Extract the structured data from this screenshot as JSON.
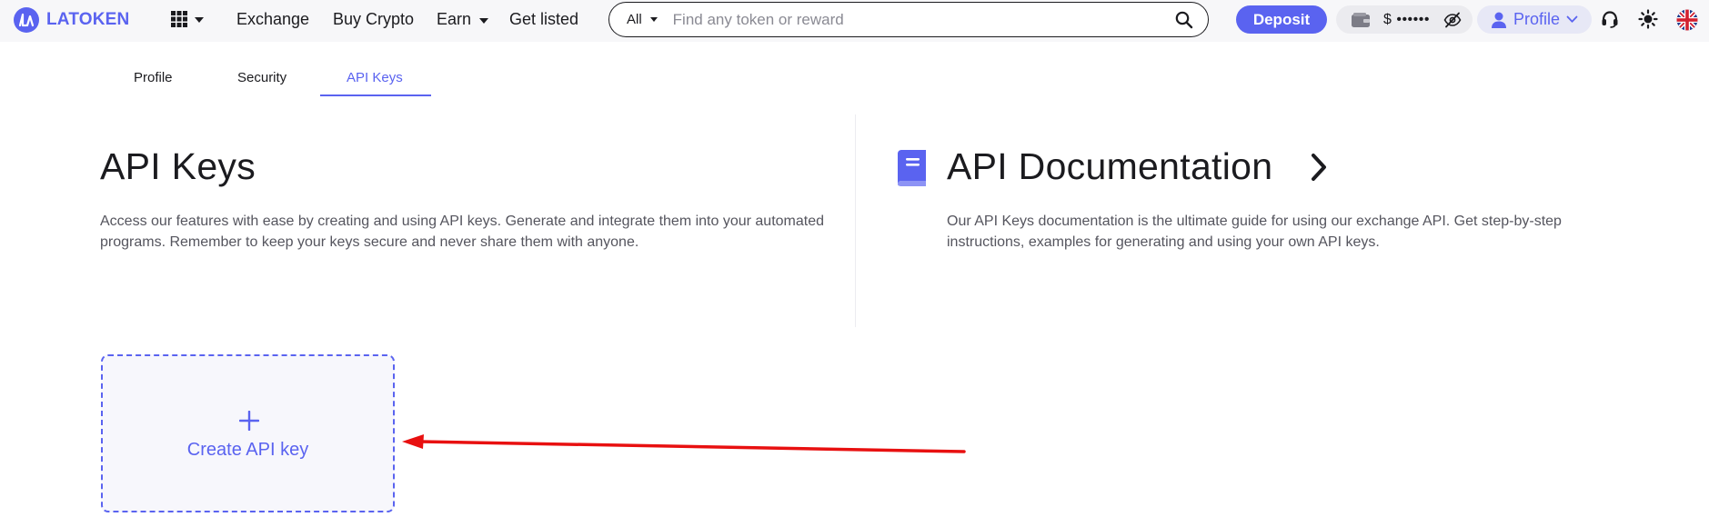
{
  "brand": {
    "name": "LATOKEN",
    "color": "#5a63f0"
  },
  "nav": {
    "grid_icon": "grid-icon",
    "links": [
      {
        "label": "Exchange"
      },
      {
        "label": "Buy Crypto"
      },
      {
        "label": "Earn",
        "has_dropdown": true
      },
      {
        "label": "Get listed"
      }
    ]
  },
  "search": {
    "category": "All",
    "placeholder": "Find any token or reward",
    "value": ""
  },
  "header_actions": {
    "deposit_label": "Deposit",
    "balance": "$ ••••••",
    "profile_label": "Profile",
    "icons": [
      "wallet-icon",
      "eye-off-icon",
      "user-icon",
      "support-icon",
      "theme-icon",
      "uk-flag-icon"
    ]
  },
  "tabs": [
    {
      "label": "Profile",
      "active": false
    },
    {
      "label": "Security",
      "active": false
    },
    {
      "label": "API Keys",
      "active": true
    }
  ],
  "api_keys": {
    "title": "API Keys",
    "description": "Access our features with ease by creating and using API keys. Generate and integrate them into your automated programs. Remember to keep your keys secure and never share them with anyone.",
    "create_label": "Create API key"
  },
  "api_docs": {
    "title": "API Documentation",
    "description": "Our API Keys documentation is the ultimate guide for using our exchange API. Get step-by-step instructions, examples for generating and using your own API keys."
  },
  "colors": {
    "accent": "#5a63f0",
    "annotation_arrow": "#e81010",
    "text": "#1b1b1f",
    "muted_text": "#55555e"
  }
}
